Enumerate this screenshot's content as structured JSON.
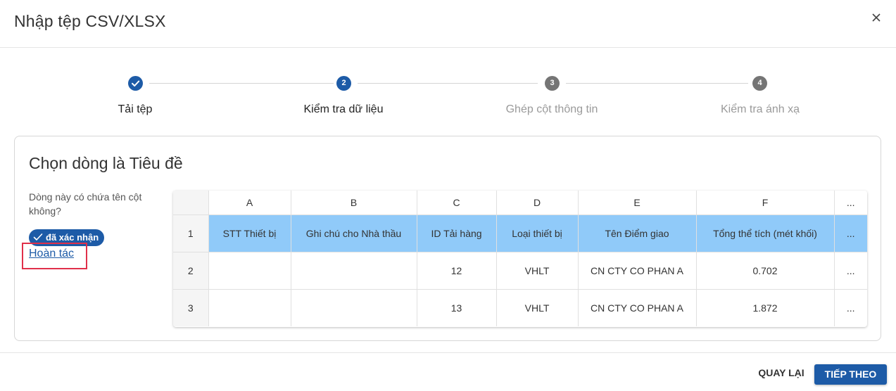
{
  "dialog": {
    "title": "Nhập tệp CSV/XLSX"
  },
  "stepper": {
    "steps": [
      {
        "label": "Tải tệp",
        "number": "",
        "state": "done"
      },
      {
        "label": "Kiểm tra dữ liệu",
        "number": "2",
        "state": "active"
      },
      {
        "label": "Ghép cột thông tin",
        "number": "3",
        "state": "todo"
      },
      {
        "label": "Kiểm tra ánh xạ",
        "number": "4",
        "state": "todo"
      }
    ]
  },
  "card": {
    "title": "Chọn dòng là Tiêu đề",
    "question": "Dòng này có chứa tên cột không?",
    "badge": "đã xác nhận",
    "undo": "Hoàn tác"
  },
  "table": {
    "columns": [
      "A",
      "B",
      "C",
      "D",
      "E",
      "F",
      "..."
    ],
    "rows": [
      {
        "num": "1",
        "cells": [
          "STT Thiết bị",
          "Ghi chú cho Nhà thầu",
          "ID Tải hàng",
          "Loại thiết bị",
          "Tên Điểm giao",
          "Tổng thể tích (mét khối)",
          "..."
        ]
      },
      {
        "num": "2",
        "cells": [
          "",
          "",
          "12",
          "VHLT",
          "CN CTY CO PHAN A",
          "0.702",
          "..."
        ]
      },
      {
        "num": "3",
        "cells": [
          "",
          "",
          "13",
          "VHLT",
          "CN CTY CO PHAN A",
          "1.872",
          "..."
        ]
      }
    ]
  },
  "footer": {
    "back": "QUAY LẠI",
    "next": "TIẾP THEO"
  },
  "colors": {
    "primary": "#1d5ba7",
    "header_row_highlight": "#90caf9",
    "step_inactive": "#757575",
    "highlight_box": "#e0304a"
  },
  "icons": {
    "close": "close-icon",
    "step_done": "check-icon",
    "badge": "check-icon"
  }
}
